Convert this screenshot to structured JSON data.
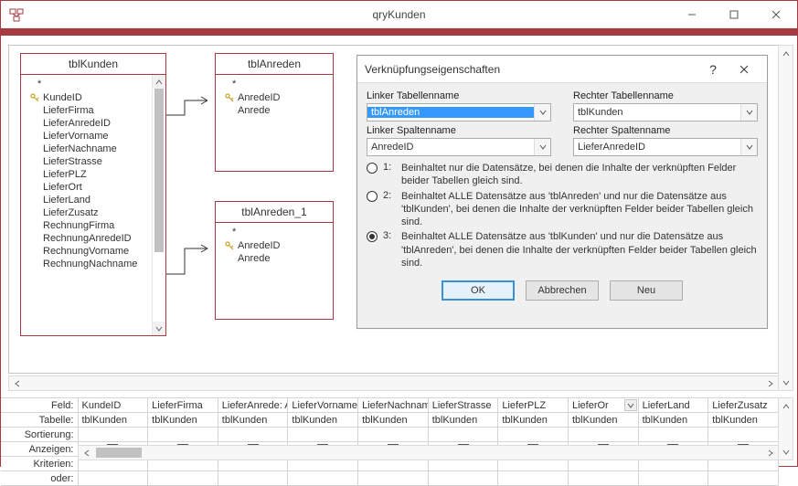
{
  "window": {
    "title": "qryKunden"
  },
  "tables": {
    "tblKunden": {
      "name": "tblKunden",
      "star": "*",
      "fields": [
        {
          "label": "KundeID",
          "pk": true
        },
        {
          "label": "LieferFirma",
          "pk": false
        },
        {
          "label": "LieferAnredeID",
          "pk": false
        },
        {
          "label": "LieferVorname",
          "pk": false
        },
        {
          "label": "LieferNachname",
          "pk": false
        },
        {
          "label": "LieferStrasse",
          "pk": false
        },
        {
          "label": "LieferPLZ",
          "pk": false
        },
        {
          "label": "LieferOrt",
          "pk": false
        },
        {
          "label": "LieferLand",
          "pk": false
        },
        {
          "label": "LieferZusatz",
          "pk": false
        },
        {
          "label": "RechnungFirma",
          "pk": false
        },
        {
          "label": "RechnungAnredeID",
          "pk": false
        },
        {
          "label": "RechnungVorname",
          "pk": false
        },
        {
          "label": "RechnungNachname",
          "pk": false
        }
      ]
    },
    "tblAnreden": {
      "name": "tblAnreden",
      "star": "*",
      "fields": [
        {
          "label": "AnredeID",
          "pk": true
        },
        {
          "label": "Anrede",
          "pk": false
        }
      ]
    },
    "tblAnreden_1": {
      "name": "tblAnreden_1",
      "star": "*",
      "fields": [
        {
          "label": "AnredeID",
          "pk": true
        },
        {
          "label": "Anrede",
          "pk": false
        }
      ]
    }
  },
  "dialog": {
    "title": "Verknüpfungseigenschaften",
    "left_table_label": "Linker Tabellenname",
    "right_table_label": "Rechter Tabellenname",
    "left_table_value": "tblAnreden",
    "right_table_value": "tblKunden",
    "left_col_label": "Linker Spaltenname",
    "right_col_label": "Rechter Spaltenname",
    "left_col_value": "AnredeID",
    "right_col_value": "LieferAnredeID",
    "options": [
      {
        "num": "1:",
        "text": "Beinhaltet nur die Datensätze, bei denen die Inhalte der verknüpften Felder beider Tabellen gleich sind.",
        "checked": false
      },
      {
        "num": "2:",
        "text": "Beinhaltet ALLE Datensätze aus 'tblAnreden' und nur die Datensätze aus 'tblKunden', bei denen die Inhalte der verknüpften Felder beider Tabellen gleich sind.",
        "checked": false
      },
      {
        "num": "3:",
        "text": "Beinhaltet ALLE Datensätze aus 'tblKunden' und nur die Datensätze aus 'tblAnreden', bei denen die Inhalte der verknüpften Felder beider Tabellen gleich sind.",
        "checked": true
      }
    ],
    "ok": "OK",
    "cancel": "Abbrechen",
    "new": "Neu"
  },
  "qbe": {
    "rows": {
      "field": "Feld:",
      "table": "Tabelle:",
      "sort": "Sortierung:",
      "show": "Anzeigen:",
      "criteria": "Kriterien:",
      "or": "oder:"
    },
    "columns": [
      {
        "field": "KundeID",
        "table": "tblKunden",
        "show": true
      },
      {
        "field": "LieferFirma",
        "table": "tblKunden",
        "show": true
      },
      {
        "field": "LieferAnrede: Anrede",
        "table": "tblKunden",
        "show": true
      },
      {
        "field": "LieferVorname",
        "table": "tblKunden",
        "show": true
      },
      {
        "field": "LieferNachname",
        "table": "tblKunden",
        "show": true
      },
      {
        "field": "LieferStrasse",
        "table": "tblKunden",
        "show": true
      },
      {
        "field": "LieferPLZ",
        "table": "tblKunden",
        "show": true
      },
      {
        "field": "LieferOr",
        "table": "tblKunden",
        "show": true,
        "active": true
      },
      {
        "field": "LieferLand",
        "table": "tblKunden",
        "show": true
      },
      {
        "field": "LieferZusatz",
        "table": "tblKunden",
        "show": true
      }
    ]
  }
}
